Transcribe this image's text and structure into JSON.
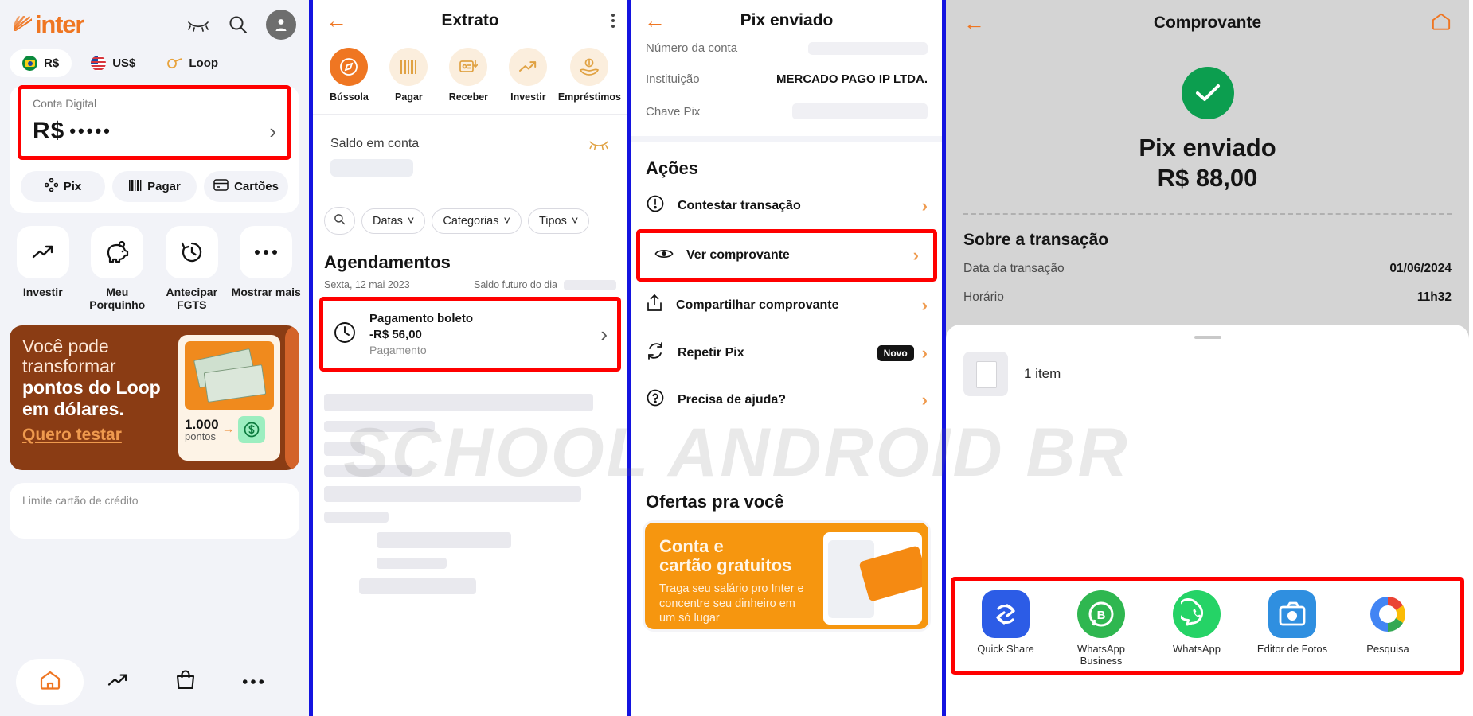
{
  "watermark": "SCHOOL ANDROID BR",
  "panel1": {
    "brand": "inter",
    "header_icons": [
      "eye-closed-icon",
      "search-icon",
      "profile-avatar"
    ],
    "currency_tabs": [
      {
        "label": "R$",
        "icon": "flag-brazil-icon",
        "active": true
      },
      {
        "label": "US$",
        "icon": "flag-usa-icon",
        "active": false
      },
      {
        "label": "Loop",
        "icon": "loop-icon",
        "active": false
      }
    ],
    "account": {
      "label": "Conta Digital",
      "currency": "R$",
      "masked_value": "•••••"
    },
    "quick_actions": [
      {
        "label": "Pix",
        "icon": "pix-icon"
      },
      {
        "label": "Pagar",
        "icon": "barcode-icon"
      },
      {
        "label": "Cartões",
        "icon": "card-icon"
      }
    ],
    "shortcuts": [
      {
        "label": "Investir",
        "icon": "trending-up-icon"
      },
      {
        "label": "Meu Porquinho",
        "icon": "piggy-bank-icon"
      },
      {
        "label": "Antecipar FGTS",
        "icon": "history-clock-icon"
      },
      {
        "label": "Mostrar mais",
        "icon": "ellipsis-icon"
      }
    ],
    "promo": {
      "line1": "Você pode",
      "line2": "transformar",
      "line3": "pontos do Loop",
      "line4": "em dólares.",
      "cta": "Quero testar",
      "points_value": "1.000",
      "points_label": "pontos"
    },
    "limit_label": "Limite cartão de crédito",
    "bottom_nav": [
      {
        "icon": "home-icon",
        "active": true
      },
      {
        "icon": "trending-up-icon",
        "active": false
      },
      {
        "icon": "shopping-bag-icon",
        "active": false
      },
      {
        "icon": "ellipsis-icon",
        "active": false
      }
    ]
  },
  "panel2": {
    "title": "Extrato",
    "back_icon": "back-arrow-icon",
    "menu_icon": "kebab-menu-icon",
    "shortcuts": [
      {
        "label": "Bússola",
        "icon": "compass-icon",
        "active": true
      },
      {
        "label": "Pagar",
        "icon": "barcode-icon",
        "active": false
      },
      {
        "label": "Receber",
        "icon": "receive-money-icon",
        "active": false
      },
      {
        "label": "Investir",
        "icon": "trending-up-icon",
        "active": false
      },
      {
        "label": "Empréstimos",
        "icon": "loan-hand-icon",
        "active": false
      }
    ],
    "balance_label": "Saldo em conta",
    "eye_icon": "eye-closed-icon",
    "filters": [
      {
        "label": "",
        "icon": "search-icon"
      },
      {
        "label": "Datas",
        "icon": "chevron-down-icon"
      },
      {
        "label": "Categorias",
        "icon": "chevron-down-icon"
      },
      {
        "label": "Tipos",
        "icon": "chevron-down-icon"
      }
    ],
    "section_title": "Agendamentos",
    "date_label": "Sexta, 12 mai 2023",
    "future_balance_label": "Saldo futuro do dia",
    "transaction": {
      "icon": "clock-icon",
      "title": "Pagamento boleto",
      "amount": "-R$ 56,00",
      "category": "Pagamento",
      "chevron": "chevron-right-icon"
    }
  },
  "panel3": {
    "title": "Pix enviado",
    "back_icon": "back-arrow-icon",
    "details": [
      {
        "key": "Número da conta",
        "value": "",
        "masked": true
      },
      {
        "key": "Instituição",
        "value": "MERCADO PAGO IP LTDA.",
        "masked": false
      },
      {
        "key": "Chave Pix",
        "value": "",
        "masked": true
      }
    ],
    "actions_title": "Ações",
    "actions": [
      {
        "label": "Contestar transação",
        "icon": "alert-circle-icon",
        "badge": "",
        "highlighted": false
      },
      {
        "label": "Ver comprovante",
        "icon": "eye-icon",
        "badge": "",
        "highlighted": true
      },
      {
        "label": "Compartilhar comprovante",
        "icon": "share-upload-icon",
        "badge": "",
        "highlighted": false
      },
      {
        "label": "Repetir Pix",
        "icon": "refresh-icon",
        "badge": "Novo",
        "highlighted": false
      },
      {
        "label": "Precisa de ajuda?",
        "icon": "help-circle-icon",
        "badge": "",
        "highlighted": false
      }
    ],
    "offers_title": "Ofertas pra você",
    "offer": {
      "line1": "Conta e",
      "line2": "cartão gratuitos",
      "body": "Traga seu salário pro Inter e concentre seu dinheiro em um só lugar"
    }
  },
  "panel4": {
    "title": "Comprovante",
    "back_icon": "back-arrow-icon",
    "home_icon": "home-icon",
    "status_icon": "check-circle-icon",
    "status_title": "Pix enviado",
    "amount": "R$ 88,00",
    "section_title": "Sobre a transação",
    "details": [
      {
        "key": "Data da transação",
        "value": "01/06/2024"
      },
      {
        "key": "Horário",
        "value": "11h32"
      }
    ],
    "item_count": "1 item",
    "file_icon": "file-icon",
    "share_targets": [
      {
        "label": "Quick Share",
        "icon": "quick-share-icon",
        "color": "#2c5ce6"
      },
      {
        "label": "WhatsApp Business",
        "icon": "whatsapp-business-icon",
        "color": "#2fb750"
      },
      {
        "label": "WhatsApp",
        "icon": "whatsapp-icon",
        "color": "#25d366"
      },
      {
        "label": "Editor de Fotos",
        "icon": "photo-editor-icon",
        "color": "#2f8fe0"
      },
      {
        "label": "Pesquisa",
        "icon": "google-search-icon",
        "color": "#f4b400"
      }
    ]
  }
}
